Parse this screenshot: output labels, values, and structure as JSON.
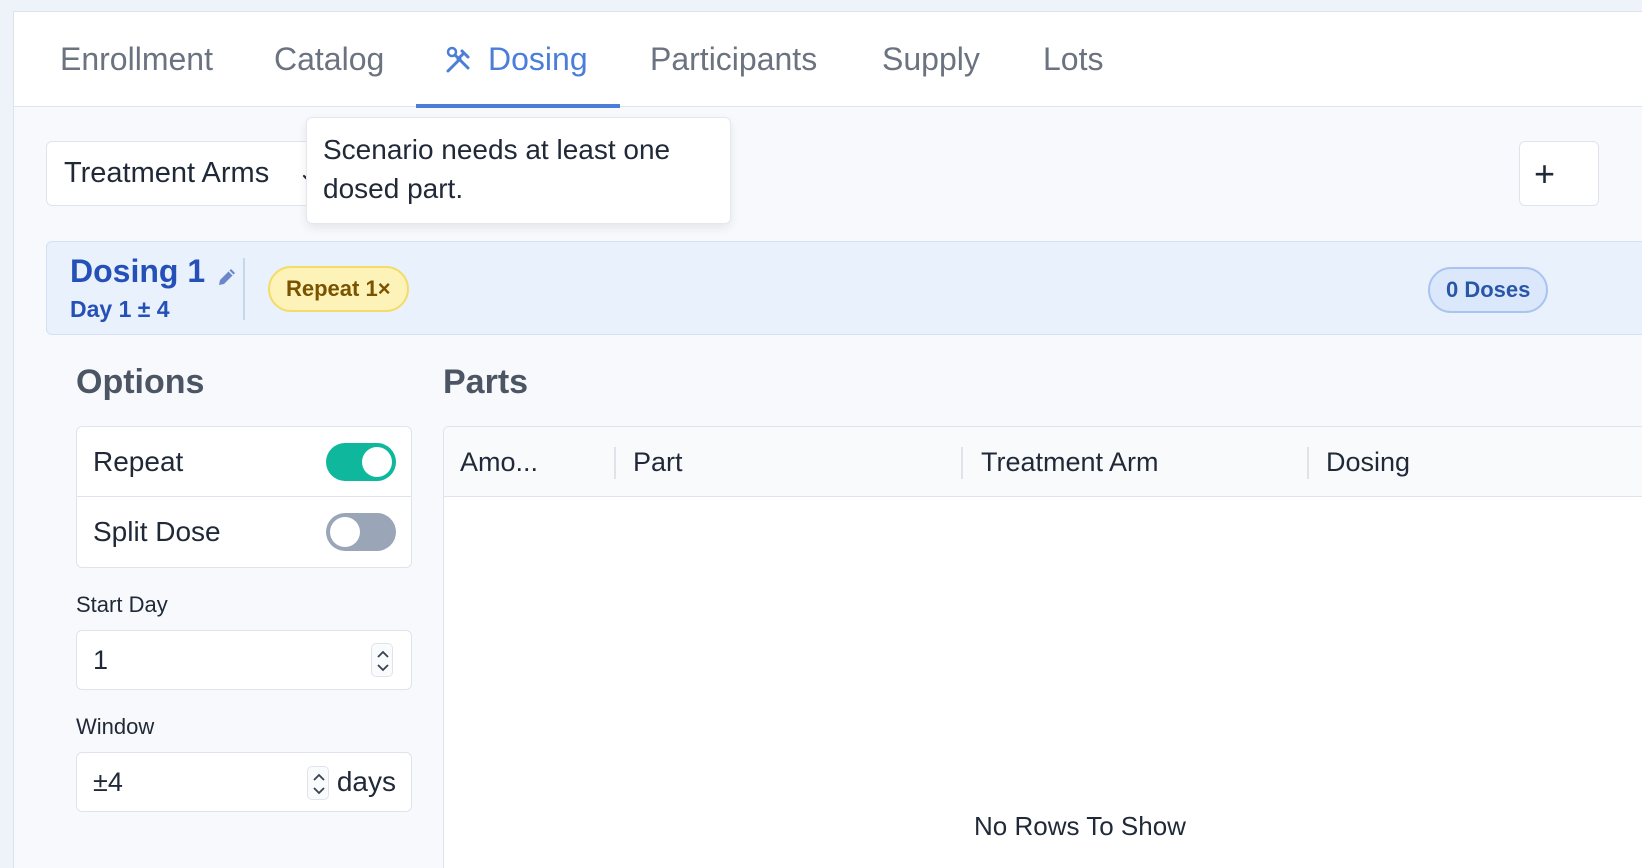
{
  "tabs": [
    {
      "label": "Enrollment"
    },
    {
      "label": "Catalog"
    },
    {
      "label": "Dosing",
      "active": true,
      "icon": "tools-icon"
    },
    {
      "label": "Participants"
    },
    {
      "label": "Supply"
    },
    {
      "label": "Lots"
    }
  ],
  "toolbar": {
    "select_value": "Treatment Arms",
    "add_label": "+"
  },
  "tooltip": {
    "text": "Scenario needs at least one dosed part."
  },
  "dosing": {
    "title": "Dosing 1",
    "subtitle": "Day 1 ± 4",
    "repeat_badge": "Repeat 1×",
    "doses_badge": "0 Doses"
  },
  "options": {
    "heading": "Options",
    "repeat_label": "Repeat",
    "repeat_on": true,
    "split_label": "Split Dose",
    "split_on": false,
    "start_day_label": "Start Day",
    "start_day_value": "1",
    "window_label": "Window",
    "window_value": "±4",
    "window_unit": "days"
  },
  "parts": {
    "heading": "Parts",
    "columns": [
      "Amo...",
      "Part",
      "Treatment Arm",
      "Dosing"
    ],
    "empty_text": "No Rows To Show"
  },
  "colors": {
    "accent": "#4a7ed9",
    "toggle_on": "#0fb89c",
    "toggle_off": "#9aa6b8",
    "repeat_badge_bg": "#fdf3b8",
    "doses_badge_bg": "#dbe8fb"
  }
}
